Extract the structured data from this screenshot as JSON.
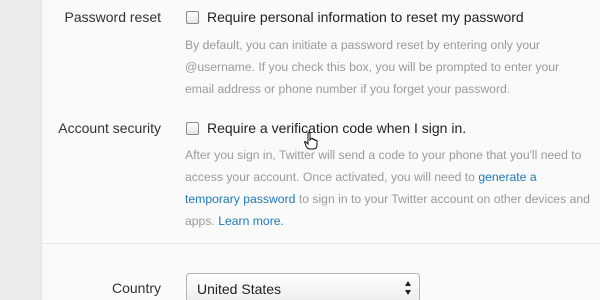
{
  "password_reset": {
    "label": "Password reset",
    "checkbox_label": "Require personal information to reset my password",
    "checked": false,
    "description": "By default, you can initiate a password reset by entering only your @username. If you check this box, you will be prompted to enter your email address or phone number if you forget your password."
  },
  "account_security": {
    "label": "Account security",
    "checkbox_label": "Require a verification code when I sign in.",
    "checked": false,
    "description_part1": "After you sign in, Twitter will send a code to your phone that you'll need to access your account. Once activated, you will need to",
    "link_text": "generate a temporary password",
    "description_part2": "to sign in to your Twitter account on other devices and apps.",
    "learn_more": "Learn more."
  },
  "country": {
    "label": "Country",
    "selected": "United States"
  },
  "colors": {
    "link": "#1f7ab3",
    "description": "#9a9a9a"
  }
}
